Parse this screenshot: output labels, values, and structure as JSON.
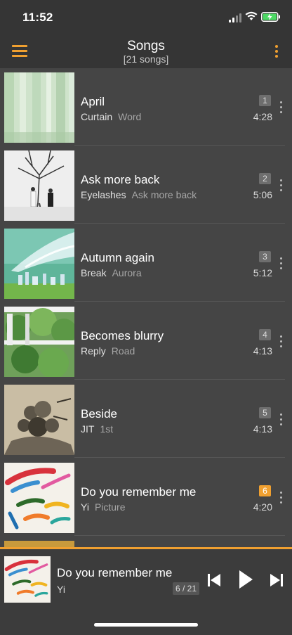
{
  "status_bar": {
    "time": "11:52"
  },
  "header": {
    "title": "Songs",
    "subtitle": "[21 songs]"
  },
  "songs": [
    {
      "title": "April",
      "artist": "Curtain",
      "album": "Word",
      "number": "1",
      "duration": "4:28"
    },
    {
      "title": "Ask more back",
      "artist": "Eyelashes",
      "album": "Ask more back",
      "number": "2",
      "duration": "5:06"
    },
    {
      "title": "Autumn again",
      "artist": "Break",
      "album": "Aurora",
      "number": "3",
      "duration": "5:12"
    },
    {
      "title": "Becomes blurry",
      "artist": "Reply",
      "album": "Road",
      "number": "4",
      "duration": "4:13"
    },
    {
      "title": "Beside",
      "artist": "JIT",
      "album": "1st",
      "number": "5",
      "duration": "4:13"
    },
    {
      "title": "Do you remember me",
      "artist": "Yi",
      "album": "Picture",
      "number": "6",
      "duration": "4:20",
      "playing": true
    }
  ],
  "now_playing": {
    "title": "Do you remember me",
    "artist": "Yi",
    "position": "6 / 21"
  },
  "colors": {
    "accent": "#f0a030",
    "background": "#454545",
    "bar": "#353535"
  },
  "icons": [
    "menu-icon",
    "more-vertical-icon",
    "previous-icon",
    "play-icon",
    "next-icon"
  ]
}
